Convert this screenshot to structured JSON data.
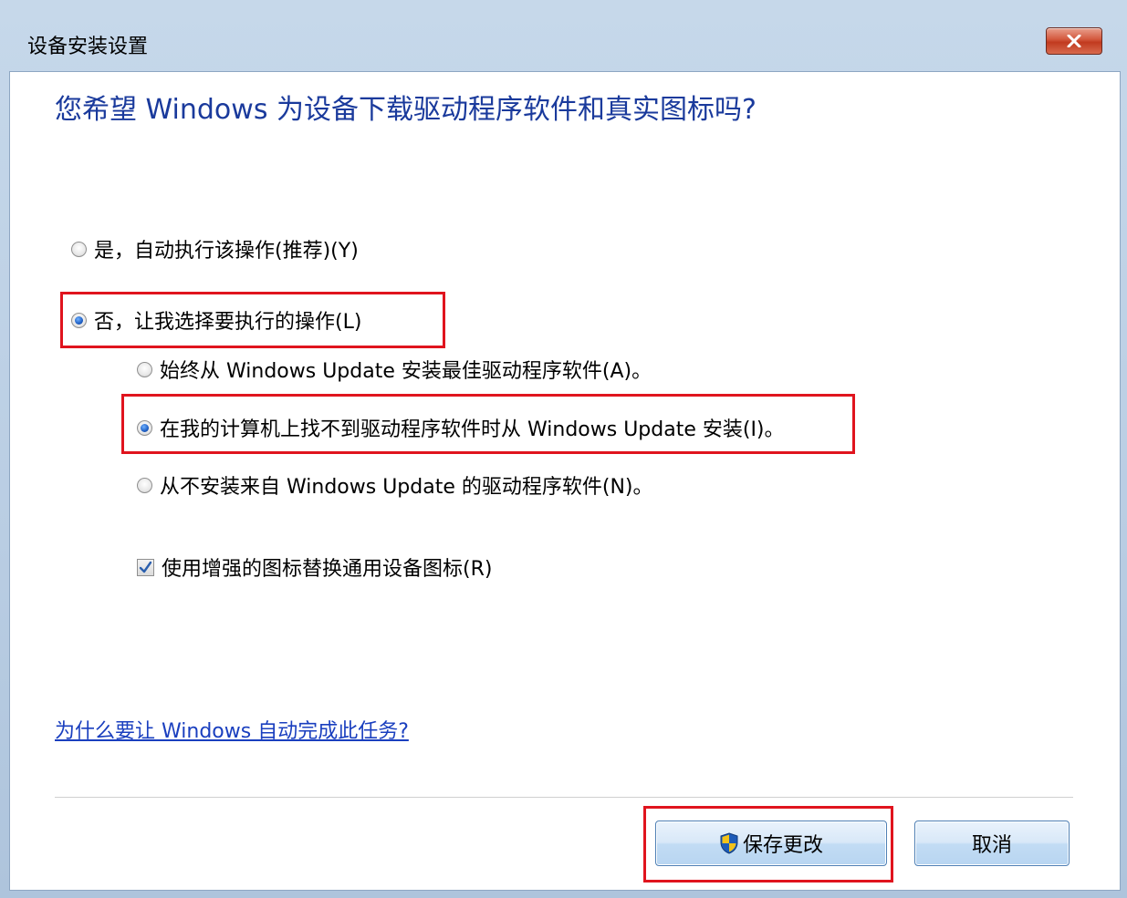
{
  "window": {
    "title": "设备安装设置"
  },
  "heading": "您希望 Windows 为设备下载驱动程序软件和真实图标吗?",
  "options": {
    "yes_auto": {
      "label": "是，自动执行该操作(推荐)(Y)",
      "checked": false
    },
    "no_choose": {
      "label": "否，让我选择要执行的操作(L)",
      "checked": true
    },
    "always_update": {
      "label": "始终从 Windows Update 安装最佳驱动程序软件(A)。",
      "checked": false
    },
    "if_not_found": {
      "label": "在我的计算机上找不到驱动程序软件时从 Windows Update 安装(I)。",
      "checked": true
    },
    "never_install": {
      "label": "从不安装来自 Windows Update 的驱动程序软件(N)。",
      "checked": false
    },
    "enhanced_icons": {
      "label": "使用增强的图标替换通用设备图标(R)",
      "checked": true
    }
  },
  "link": "为什么要让 Windows 自动完成此任务?",
  "buttons": {
    "save": "保存更改",
    "cancel": "取消"
  },
  "icons": {
    "close": "close-icon",
    "shield": "uac-shield-icon"
  },
  "colors": {
    "heading": "#1a3a9c",
    "highlight": "#e0141e",
    "link": "#1a3fbf"
  }
}
